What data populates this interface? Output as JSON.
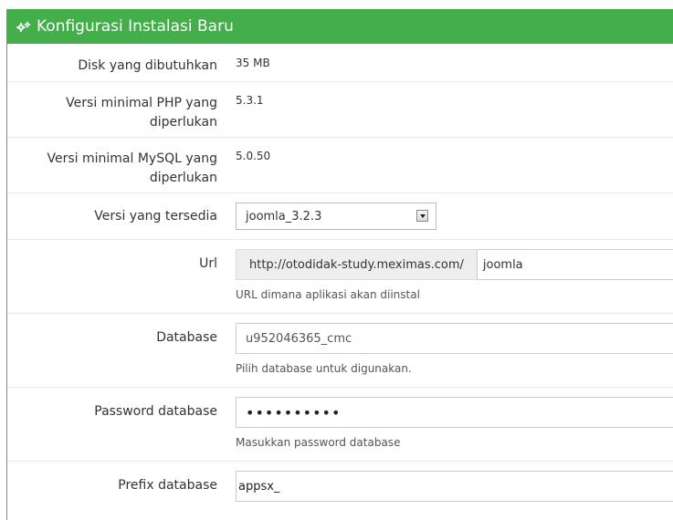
{
  "header": {
    "title": "Konfigurasi Instalasi Baru",
    "icon": "cogs-icon"
  },
  "rows": {
    "disk": {
      "label": "Disk yang dibutuhkan",
      "value": "35 MB"
    },
    "php": {
      "label_line1": "Versi minimal PHP yang",
      "label_line2": "diperlukan",
      "value": "5.3.1"
    },
    "mysql": {
      "label_line1": "Versi minimal MySQL yang",
      "label_line2": "diperlukan",
      "value": "5.0.50"
    },
    "version": {
      "label": "Versi yang tersedia",
      "selected": "joomla_3.2.3"
    },
    "url": {
      "label": "Url",
      "prefix": "http://otodidak-study.meximas.com/",
      "value": "joomla",
      "help": "URL dimana aplikasi akan diinstal"
    },
    "database": {
      "label": "Database",
      "value": "u952046365_cmc",
      "help": "Pilih database untuk digunakan."
    },
    "password": {
      "label": "Password database",
      "value": "••••••••••",
      "help": "Masukkan password database"
    },
    "prefix": {
      "label": "Prefix database",
      "value": "appsx_"
    }
  },
  "colors": {
    "header_bg": "#43ae4a",
    "border": "#e9e9e9"
  }
}
